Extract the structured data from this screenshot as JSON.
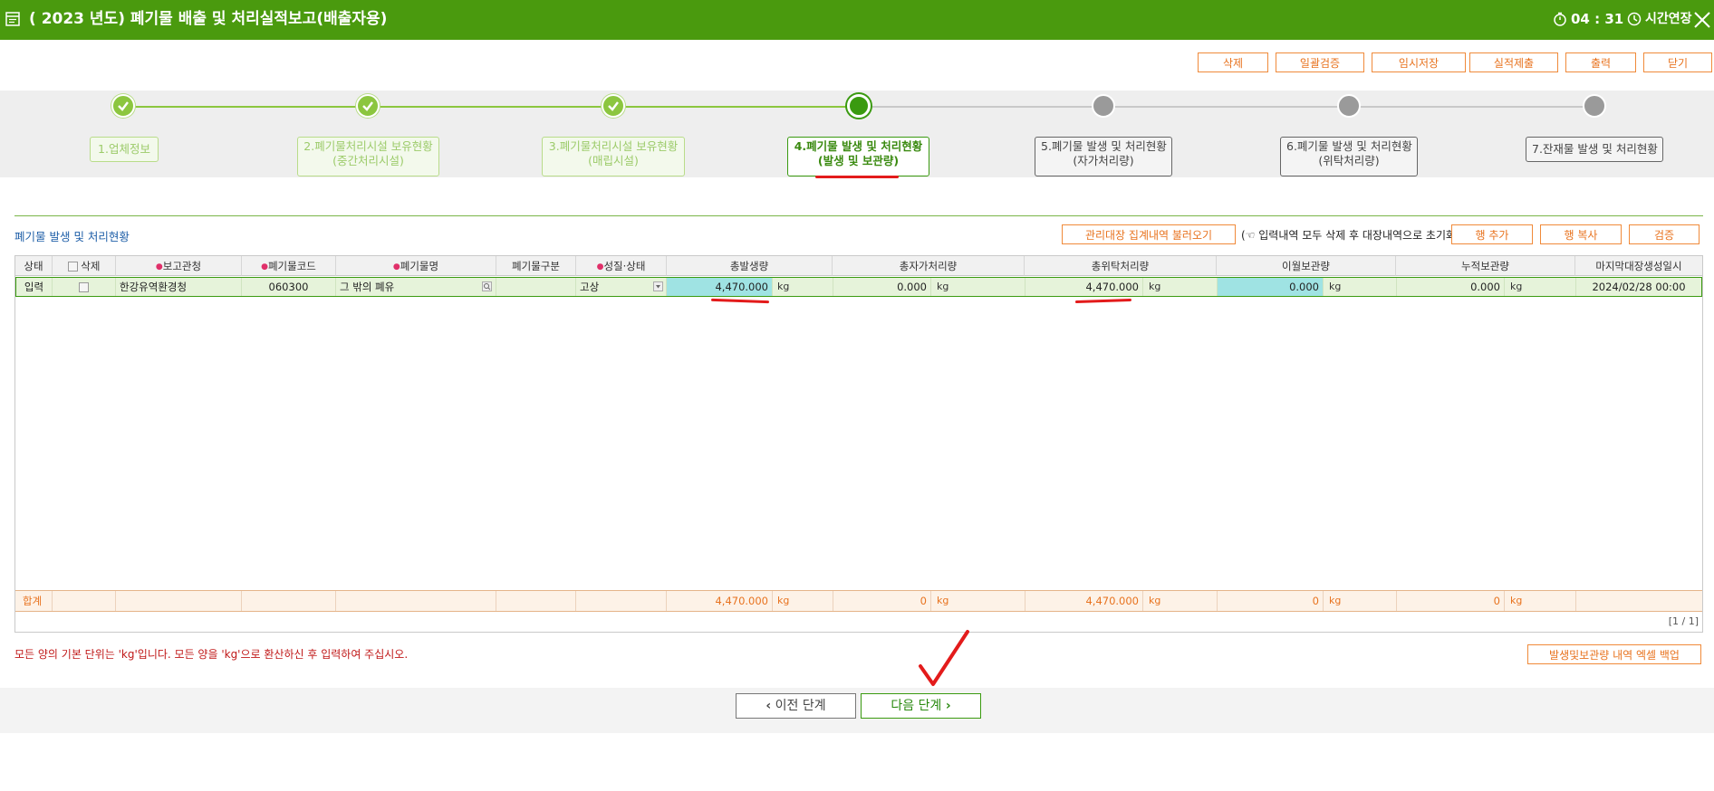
{
  "window": {
    "title": "( 2023 년도) 폐기물 배출 및 처리실적보고(배출자용)",
    "timer": "04 : 31",
    "extend_label": "시간연장"
  },
  "toolbar": {
    "buttons": [
      "삭제",
      "일괄검증",
      "임시저장",
      "실적제출",
      "출력",
      "닫기"
    ]
  },
  "steps": [
    {
      "line1": "1.업체정보",
      "line2": "",
      "state": "done"
    },
    {
      "line1": "2.폐기물처리시설 보유현황",
      "line2": "(중간처리시설)",
      "state": "done"
    },
    {
      "line1": "3.폐기물처리시설 보유현황",
      "line2": "(매립시설)",
      "state": "done"
    },
    {
      "line1": "4.폐기물 발생 및 처리현황",
      "line2": "(발생 및 보관량)",
      "state": "current"
    },
    {
      "line1": "5.폐기물 발생 및 처리현황",
      "line2": "(자가처리량)",
      "state": "todo"
    },
    {
      "line1": "6.폐기물 발생 및 처리현황",
      "line2": "(위탁처리량)",
      "state": "todo"
    },
    {
      "line1": "7.잔재물 발생 및 처리현황",
      "line2": "",
      "state": "todo"
    }
  ],
  "section": {
    "title": "폐기물 발생 및 처리현황",
    "load_button": "관리대장 집계내역 불러오기",
    "note": "(☜ 입력내역 모두 삭제 후 대장내역으로 초기화)",
    "add_row": "행 추가",
    "copy_row": "행 복사",
    "verify": "검증"
  },
  "grid": {
    "headers": {
      "status": "상태",
      "delete": "삭제",
      "office": "보고관청",
      "code": "폐기물코드",
      "name": "폐기물명",
      "category": "폐기물구분",
      "nature": "성질·상태",
      "total_gen": "총발생량",
      "self_proc": "총자가처리량",
      "consigned": "총위탁처리량",
      "carried": "이월보관량",
      "accum": "누적보관량",
      "last_date": "마지막대장생성일시"
    },
    "row": {
      "status": "입력",
      "office": "한강유역환경청",
      "code": "060300",
      "name": "그 밖의 폐유",
      "category": "",
      "nature": "고상",
      "total_gen": "4,470.000",
      "self_proc": "0.000",
      "consigned": "4,470.000",
      "carried": "0.000",
      "accum": "0.000",
      "last_date": "2024/02/28 00:00",
      "unit": "kg"
    },
    "sum": {
      "label": "합계",
      "total_gen": "4,470.000",
      "self_proc": "0",
      "consigned": "4,470.000",
      "carried": "0",
      "accum": "0",
      "unit": "kg"
    },
    "pager": "[1 / 1]"
  },
  "footer": {
    "note": "모든 양의 기본 단위는 'kg'입니다. 모든 양을 'kg'으로 환산하신 후 입력하여 주십시오.",
    "excel_button": "발생및보관량 내역 엑셀 백업",
    "prev": "이전 단계",
    "next": "다음 단계"
  },
  "colors": {
    "title_bar": "#4a9a0e",
    "accent_orange": "#e8731f",
    "step_done": "#8cc63f",
    "step_current": "#3a9a10",
    "step_todo": "#9a9a9a",
    "highlight_cyan": "#9fe3e3",
    "annotation_red": "#e31b1b"
  }
}
